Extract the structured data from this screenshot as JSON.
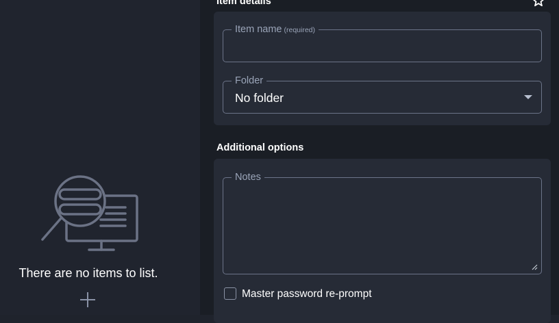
{
  "empty_state": {
    "message": "There are no items to list.",
    "illustration": "search-no-results-illustration",
    "add_icon": "plus-icon"
  },
  "item_details": {
    "title": "Item details",
    "favorite_icon": "star-icon",
    "name_field": {
      "label": "Item name",
      "hint": "(required)",
      "value": ""
    },
    "folder_field": {
      "label": "Folder",
      "value": "No folder",
      "icon": "chevron-down-icon"
    }
  },
  "additional_options": {
    "title": "Additional options",
    "notes_field": {
      "label": "Notes",
      "value": ""
    },
    "reprompt": {
      "label": "Master password re-prompt",
      "checked": false
    }
  },
  "colors": {
    "left_pane_bg": "#20242e",
    "right_pane_bg": "#1a1e25",
    "card_bg": "#262b36",
    "field_border": "#6c7489",
    "label_text": "#9aa4b8"
  }
}
